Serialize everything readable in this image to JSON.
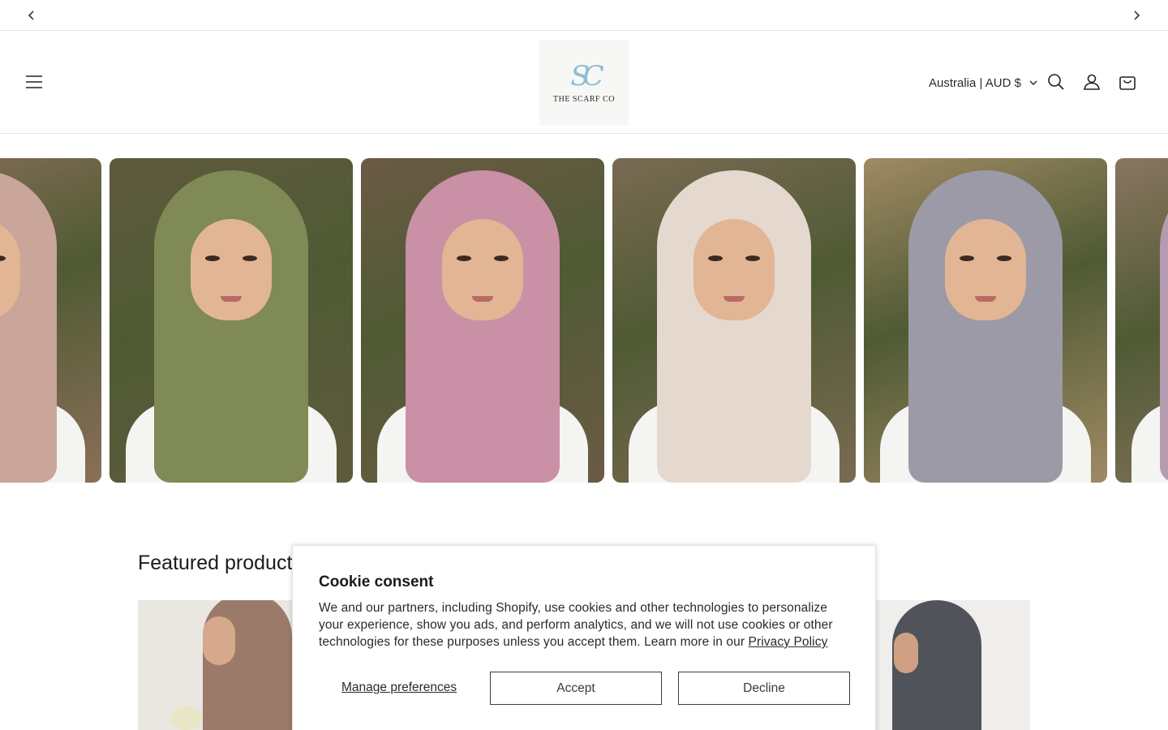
{
  "announcement": {
    "prev_icon": "chevron-left-icon",
    "next_icon": "chevron-right-icon"
  },
  "header": {
    "menu_icon": "hamburger-menu-icon",
    "logo": {
      "monogram": "SC",
      "brand": "THE SCARF CO"
    },
    "country_selector": "Australia | AUD $",
    "icons": [
      "search-icon",
      "account-icon",
      "cart-icon"
    ]
  },
  "gallery": {
    "tiles": [
      {
        "hijab_color": "#c9a59a",
        "bg": "#8b6f58"
      },
      {
        "hijab_color": "#7f8a56",
        "bg": "#5e5a3c"
      },
      {
        "hijab_color": "#c990a6",
        "bg": "#6b5a44"
      },
      {
        "hijab_color": "#e4d8cf",
        "bg": "#7a6a52"
      },
      {
        "hijab_color": "#9c9aa6",
        "bg": "#a08a64"
      },
      {
        "hijab_color": "#b69ab0",
        "bg": "#8a7560"
      }
    ]
  },
  "featured": {
    "title": "Featured products"
  },
  "cookie": {
    "title": "Cookie consent",
    "body": "We and our partners, including Shopify, use cookies and other technologies to personalize your experience, show you ads, and perform analytics, and we will not use cookies or other technologies for these purposes unless you accept them. Learn more in our ",
    "privacy_link": "Privacy Policy",
    "manage": "Manage preferences",
    "accept": "Accept",
    "decline": "Decline"
  },
  "colors": {
    "text": "#121212",
    "border": "#e6e6e6",
    "logo_accent": "#8fbcd4"
  }
}
